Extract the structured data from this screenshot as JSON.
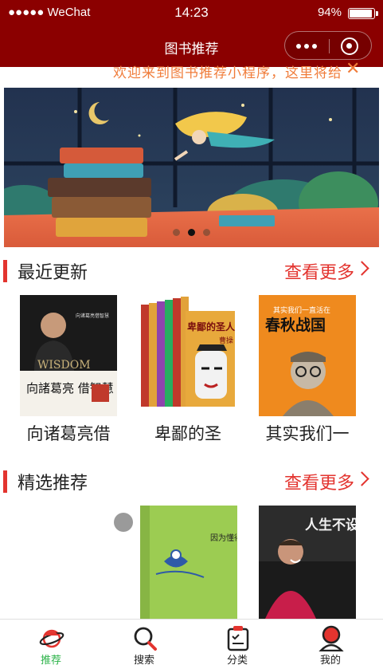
{
  "status_bar": {
    "carrier": "●●●●● WeChat",
    "time": "14:23",
    "battery": "94%"
  },
  "nav": {
    "title": "图书推荐"
  },
  "notice": {
    "text": "欢迎来到图书推荐小程序，这里将给"
  },
  "banner": {
    "slide_count": 3,
    "active_index": 1
  },
  "sections": [
    {
      "title": "最近更新",
      "more_label": "查看更多",
      "books": [
        {
          "title": "向诸葛亮借"
        },
        {
          "title": "卑鄙的圣"
        },
        {
          "title": "其实我们一"
        }
      ]
    },
    {
      "title": "精选推荐",
      "more_label": "查看更多",
      "books": [
        {
          "title": ""
        },
        {
          "title": ""
        },
        {
          "title": ""
        }
      ]
    }
  ],
  "covers": {
    "zhuge_author_line": "向诸葛亮借智慧",
    "zhuge_wisdom": "WISDOM",
    "zhuge_big": "向諸葛亮 借智慧",
    "saint_title": "卑鄙的圣人",
    "saint_author": "曹操",
    "chunqiu_top": "其实我们一直活在",
    "chunqiu_title": "春秋战国",
    "green_title": "因为懂得 所以慈悲",
    "life_title": "人生不设限"
  },
  "tabbar": {
    "items": [
      {
        "label": "推荐",
        "icon": "saturn-icon",
        "active": true
      },
      {
        "label": "搜索",
        "icon": "search-icon",
        "active": false
      },
      {
        "label": "分类",
        "icon": "category-icon",
        "active": false
      },
      {
        "label": "我的",
        "icon": "user-icon",
        "active": false
      }
    ]
  },
  "colors": {
    "nav_bg": "#8b0000",
    "accent_red": "#e3342f",
    "notice_orange": "#f07c3a",
    "tab_active": "#2db34a"
  }
}
